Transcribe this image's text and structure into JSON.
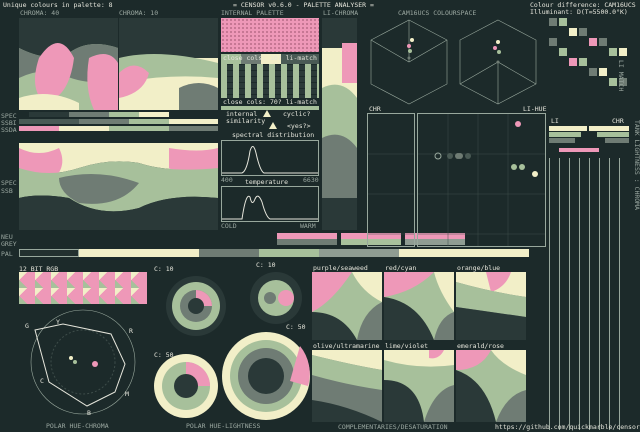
{
  "header": {
    "unique_colours": "Unique colours in palette: 8",
    "app_title": "= CENSOR v0.6.0 - PALETTE ANALYSER =",
    "colour_difference": "Colour difference: CAM16UCS",
    "illuminant": "Illuminant: D(T=5500.0°K)"
  },
  "top_labels": {
    "chroma_left": "CHROMA: 40",
    "chroma_right": "CHROMA: 10",
    "internal_palette": "INTERNAL PALETTE",
    "li_chroma": "LI-CHROMA",
    "cam_space": "CAM16UCS COLOURSPACE"
  },
  "side_labels": {
    "spec": "SPEC",
    "ssbi": "SSBI",
    "ssda": "SSDA",
    "spec2": "SPEC",
    "ssb": "SSB",
    "neu": "NEU",
    "grey": "GREY",
    "pal": "PAL"
  },
  "analysis": {
    "close_cols_1": "close cols: 10? li-match",
    "close_cols_2": "close cols: 70? li-match",
    "internal_similarity": "internal similarity",
    "cyclic": "cyclic?",
    "cyclic_answer": "<yes?>",
    "spectral": "spectral distribution",
    "spectral_lo": "400",
    "spectral_hi": "6630",
    "temperature": "temperature",
    "temp_lo": "COLD",
    "temp_hi": "WARM"
  },
  "scatter": {
    "chr": "CHR",
    "li_hue": "LI-HUE"
  },
  "right_panel": {
    "li": "LI",
    "chr": "CHR",
    "vertical_left": "LI  MATCH",
    "vertical_right": "TANK LIGHTNESS : CHROMA"
  },
  "lower": {
    "bit_rgb": "12 BIT RGB",
    "c10a": "C: 10",
    "c50a": "C: 50",
    "c50b": "C: 50",
    "c10b": "C: 10",
    "polar_hc": "POLAR HUE-CHROMA",
    "polar_hl": "POLAR HUE-LIGHTNESS",
    "complementaries": "COMPLEMENTARIES/DESATURATION",
    "github": "https://github.com/quickmarble/censor",
    "hue_labels": [
      "G",
      "Y",
      "R",
      "M",
      "B",
      "C"
    ]
  },
  "complementaries": [
    {
      "label": "purple/seaweed"
    },
    {
      "label": "red/cyan"
    },
    {
      "label": "orange/blue"
    },
    {
      "label": "olive/ultramarine"
    },
    {
      "label": "lime/violet"
    },
    {
      "label": "emerald/rose"
    }
  ],
  "colors": {
    "bg": "#1c2a2a",
    "pink": "#ee98b8",
    "cream": "#f2efc8",
    "sage": "#a7c09b",
    "grey": "#6f7c74",
    "dark": "#2a3938",
    "light": "#98a89d"
  }
}
